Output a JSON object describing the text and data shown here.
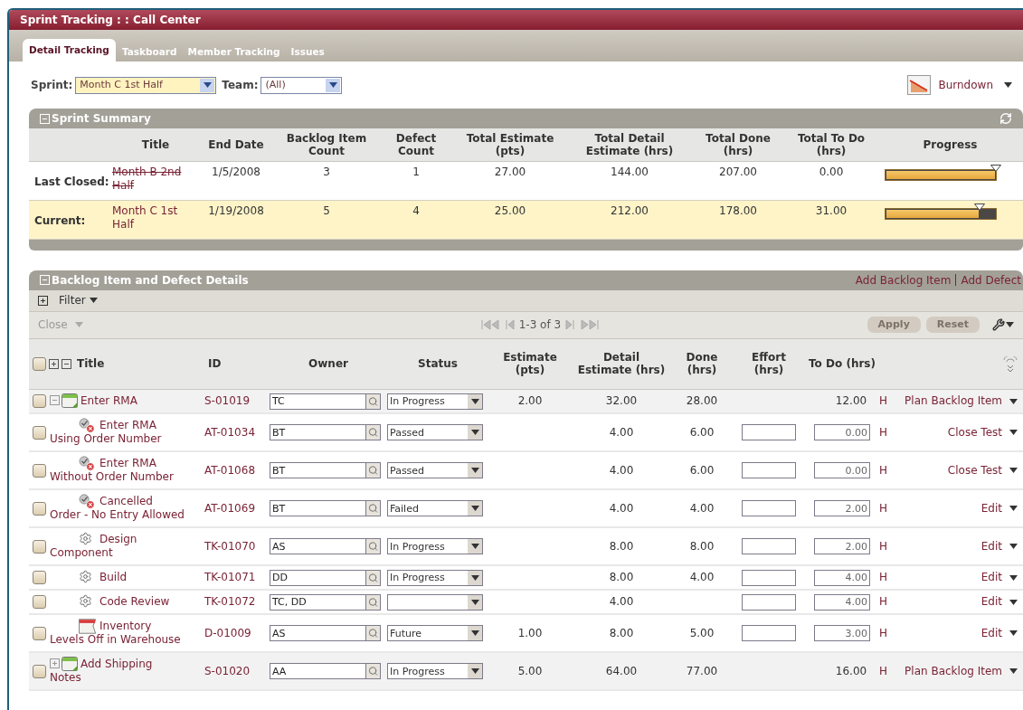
{
  "window": {
    "title": "Sprint Tracking : : Call Center"
  },
  "tabs": [
    {
      "label": "Detail Tracking",
      "selected": true
    },
    {
      "label": "Taskboard",
      "selected": false
    },
    {
      "label": "Member Tracking",
      "selected": false
    },
    {
      "label": "Issues",
      "selected": false
    }
  ],
  "filters": [
    {
      "label": "Sprint:",
      "value": "Month C 1st Half",
      "highlighted": true
    },
    {
      "label": "Team:",
      "value": "(All)",
      "highlighted": false
    }
  ],
  "chart_menu": {
    "label": "Burndown"
  },
  "sprint_summary": {
    "title": "Sprint Summary",
    "expanded": true,
    "columns": [
      "Title",
      "End Date",
      "Backlog Item Count",
      "Defect Count",
      "Total Estimate (pts)",
      "Total Detail Estimate (hrs)",
      "Total Done (hrs)",
      "Total To Do (hrs)",
      "Progress"
    ],
    "rows": [
      {
        "label": "Last Closed:",
        "title": "Month B 2nd Half",
        "closed": true,
        "selected": false,
        "end_date": "1/5/2008",
        "backlog_item_count": "3",
        "defect_count": "1",
        "total_estimate": "27.00",
        "total_detail_estimate": "144.00",
        "total_done": "207.00",
        "total_to_do": "0.00",
        "level": 1.0
      },
      {
        "label": "Current:",
        "title": "Month C 1st Half",
        "closed": false,
        "selected": true,
        "end_date": "1/19/2008",
        "backlog_item_count": "5",
        "defect_count": "4",
        "total_estimate": "25.00",
        "total_detail_estimate": "212.00",
        "total_done": "178.00",
        "total_to_do": "31.00",
        "level": 0.85
      }
    ]
  },
  "backlog": {
    "title": "Backlog Item and Defect Details",
    "expanded": true,
    "links": [
      "Add Backlog Item",
      "Add Defect"
    ],
    "filter": {
      "label": "Filter",
      "expanded": false
    },
    "bulk_action": {
      "label": "Close",
      "disabled": true
    },
    "pager": "1-3 of 3",
    "buttons": [
      {
        "label": "Apply",
        "disabled": true
      },
      {
        "label": "Reset",
        "disabled": true
      }
    ],
    "header_checkbox": {
      "checked": false
    },
    "columns": [
      "Title",
      "ID",
      "Owner",
      "Status",
      "Estimate (pts)",
      "Detail Estimate (hrs)",
      "Done (hrs)",
      "Effort (hrs)",
      "To Do (hrs)"
    ],
    "rows": [
      {
        "kind": "story",
        "checked": false,
        "expanded": true,
        "title": "Enter RMA",
        "id": "S-01019",
        "owner": "TC",
        "status": "In Progress",
        "estimate": "2.00",
        "detail_estimate": "32.00",
        "done": "28.00",
        "to_do": "12.00",
        "unit": "H",
        "action": "Plan Backlog Item",
        "children": [
          {
            "kind": "test",
            "checked": false,
            "title": "Enter RMA Using Order Number",
            "id": "AT-01034",
            "owner": "BT",
            "status": "Passed",
            "detail_estimate": "4.00",
            "done": "6.00",
            "to_do": "0.00",
            "unit": "H",
            "action": "Close Test"
          },
          {
            "kind": "test",
            "checked": false,
            "title": "Enter RMA Without Order Number",
            "id": "AT-01068",
            "owner": "BT",
            "status": "Passed",
            "detail_estimate": "4.00",
            "done": "6.00",
            "to_do": "0.00",
            "unit": "H",
            "action": "Close Test"
          },
          {
            "kind": "test",
            "checked": false,
            "title": "Cancelled Order - No Entry Allowed",
            "id": "AT-01069",
            "owner": "BT",
            "status": "Failed",
            "detail_estimate": "4.00",
            "done": "4.00",
            "to_do": "2.00",
            "unit": "H",
            "action": "Edit"
          },
          {
            "kind": "task",
            "checked": false,
            "title": "Design Component",
            "id": "TK-01070",
            "owner": "AS",
            "status": "In Progress",
            "detail_estimate": "8.00",
            "done": "8.00",
            "to_do": "2.00",
            "unit": "H",
            "action": "Edit"
          },
          {
            "kind": "task",
            "checked": false,
            "title": "Build",
            "id": "TK-01071",
            "owner": "DD",
            "status": "In Progress",
            "detail_estimate": "8.00",
            "done": "4.00",
            "to_do": "4.00",
            "unit": "H",
            "action": "Edit"
          },
          {
            "kind": "task",
            "checked": false,
            "title": "Code Review",
            "id": "TK-01072",
            "owner": "TC, DD",
            "detail_estimate": "4.00",
            "to_do": "4.00",
            "unit": "H",
            "action": "Edit"
          },
          {
            "kind": "defect",
            "checked": false,
            "title": "Inventory Levels Off in Warehouse",
            "id": "D-01009",
            "owner": "AS",
            "status": "Future",
            "estimate": "1.00",
            "detail_estimate": "8.00",
            "done": "5.00",
            "to_do": "3.00",
            "unit": "H",
            "action": "Edit"
          }
        ]
      },
      {
        "kind": "story",
        "checked": false,
        "expanded": false,
        "title": "Add Shipping Notes",
        "id": "S-01020",
        "owner": "AA",
        "status": "In Progress",
        "estimate": "5.00",
        "detail_estimate": "64.00",
        "done": "77.00",
        "to_do": "16.00",
        "unit": "H",
        "action": "Plan Backlog Item"
      }
    ]
  }
}
